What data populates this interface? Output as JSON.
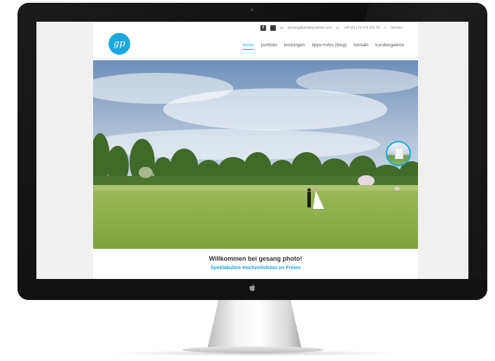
{
  "site": {
    "logo_text": "gp",
    "topbar": {
      "social_facebook": "f",
      "social_other": "",
      "email": "gesang@gesang-photo.com",
      "phone": "+49 (0) 176 576 611 50",
      "search_label": "Suchen"
    },
    "nav": {
      "items": [
        "home",
        "portfolio",
        "leistungen",
        "tipps+infos (blog)",
        "kontakt",
        "kundengalerie"
      ],
      "active": "home"
    },
    "welcome_title": "Willkommen bei gesang photo!",
    "welcome_subtitle": "Spektakuläre Hochzeitsfotos im Freien"
  },
  "colors": {
    "accent": "#1ba8e0",
    "bezel": "#111111",
    "screen_bg": "#f0f0f0"
  },
  "icons": {
    "email": "envelope-icon",
    "phone": "phone-icon",
    "search": "magnifier-icon",
    "monitor_logo": "apple-logo-icon"
  }
}
